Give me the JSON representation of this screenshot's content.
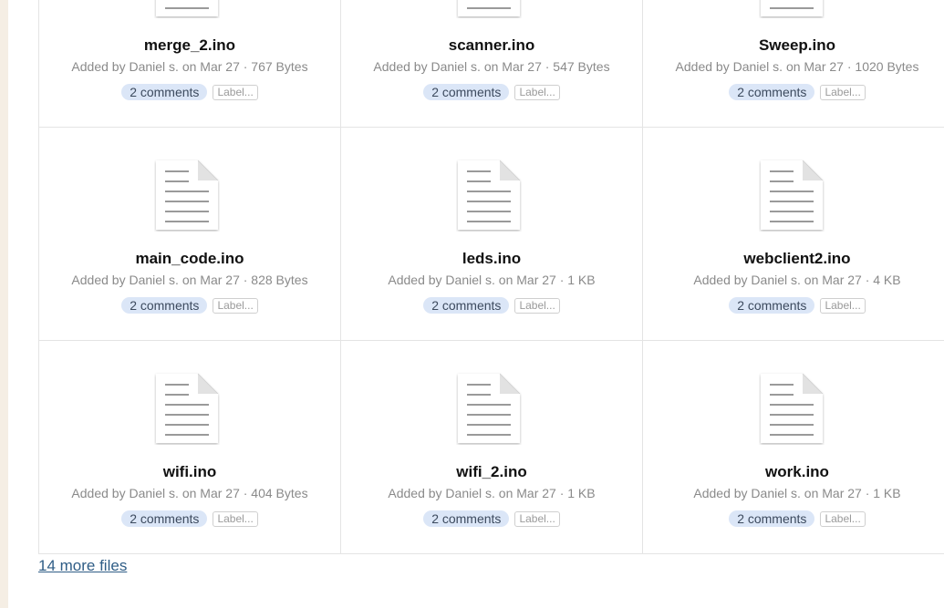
{
  "files": [
    {
      "name": "merge_2.ino",
      "meta": "Added by Daniel s. on Mar 27 · 767 Bytes",
      "comments": "2 comments",
      "label": "Label..."
    },
    {
      "name": "scanner.ino",
      "meta": "Added by Daniel s. on Mar 27 · 547 Bytes",
      "comments": "2 comments",
      "label": "Label..."
    },
    {
      "name": "Sweep.ino",
      "meta": "Added by Daniel s. on Mar 27 · 1020 Bytes",
      "comments": "2 comments",
      "label": "Label..."
    },
    {
      "name": "main_code.ino",
      "meta": "Added by Daniel s. on Mar 27 · 828 Bytes",
      "comments": "2 comments",
      "label": "Label..."
    },
    {
      "name": "leds.ino",
      "meta": "Added by Daniel s. on Mar 27 · 1 KB",
      "comments": "2 comments",
      "label": "Label..."
    },
    {
      "name": "webclient2.ino",
      "meta": "Added by Daniel s. on Mar 27 · 4 KB",
      "comments": "2 comments",
      "label": "Label..."
    },
    {
      "name": "wifi.ino",
      "meta": "Added by Daniel s. on Mar 27 · 404 Bytes",
      "comments": "2 comments",
      "label": "Label..."
    },
    {
      "name": "wifi_2.ino",
      "meta": "Added by Daniel s. on Mar 27 · 1 KB",
      "comments": "2 comments",
      "label": "Label..."
    },
    {
      "name": "work.ino",
      "meta": "Added by Daniel s. on Mar 27 · 1 KB",
      "comments": "2 comments",
      "label": "Label..."
    }
  ],
  "more_files_link": "14 more files",
  "icons": {
    "file": "document-icon"
  },
  "colors": {
    "comments_badge_bg": "#dbe6f7",
    "link": "#2f5d86",
    "meta_text": "#8a8a8a"
  }
}
